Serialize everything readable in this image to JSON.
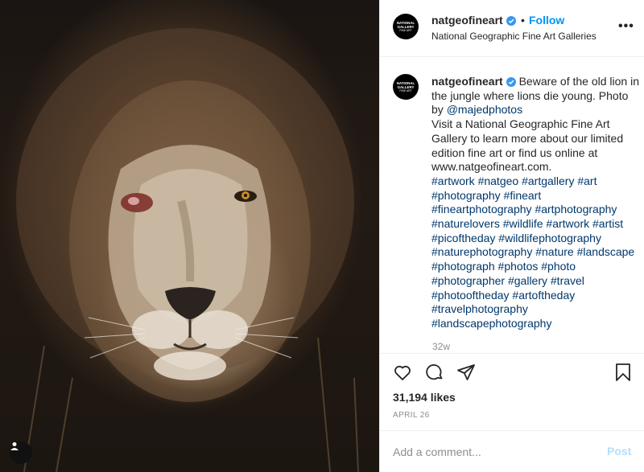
{
  "post": {
    "image_alt": "Close-up portrait of an old male lion with a scarred, injured eye",
    "photo_user_icon": "user-tag-icon"
  },
  "header": {
    "avatar_text_1": "NATIONAL",
    "avatar_text_2": "GALLERY",
    "avatar_text_3": "FINE ART",
    "username": "natgeofineart",
    "verified_icon": "verified-badge-icon",
    "dot": "•",
    "follow_label": "Follow",
    "subtitle": "National Geographic Fine Art Galleries",
    "more_icon": "more-options-icon",
    "more_label": "•••"
  },
  "caption": {
    "username": "natgeofineart",
    "text_1": "Beware of the old lion in the jungle where lions die young. Photo by ",
    "mention": "@majedphotos",
    "text_2": "Visit a National Geographic Fine Art Gallery to learn more about our limited edition fine art or find us online at www.natgeofineart.com.",
    "hashtags": [
      "#artwork",
      "#natgeo",
      "#artgallery",
      "#art",
      "#photography",
      "#fineart",
      "#fineartphotography",
      "#artphotography",
      "#naturelovers",
      "#wildlife",
      "#artwork",
      "#artist",
      "#picoftheday",
      "#wildlifephotography",
      "#naturephotography",
      "#nature",
      "#landscape",
      "#photograph",
      "#photos",
      "#photo",
      "#photographer",
      "#gallery",
      "#travel",
      "#photooftheday",
      "#artoftheday",
      "#travelphotography",
      "#landscapephotography"
    ],
    "time_ago": "32w"
  },
  "actions": {
    "like_icon": "heart-icon",
    "comment_icon": "comment-icon",
    "share_icon": "share-icon",
    "save_icon": "bookmark-icon",
    "likes": "31,194 likes",
    "date": "APRIL 26"
  },
  "comment": {
    "placeholder": "Add a comment...",
    "post_label": "Post"
  },
  "colors": {
    "accent": "#0095f6",
    "hashtag": "#00376b",
    "muted": "#8e8e8e",
    "post_disabled": "#b2dffc"
  }
}
